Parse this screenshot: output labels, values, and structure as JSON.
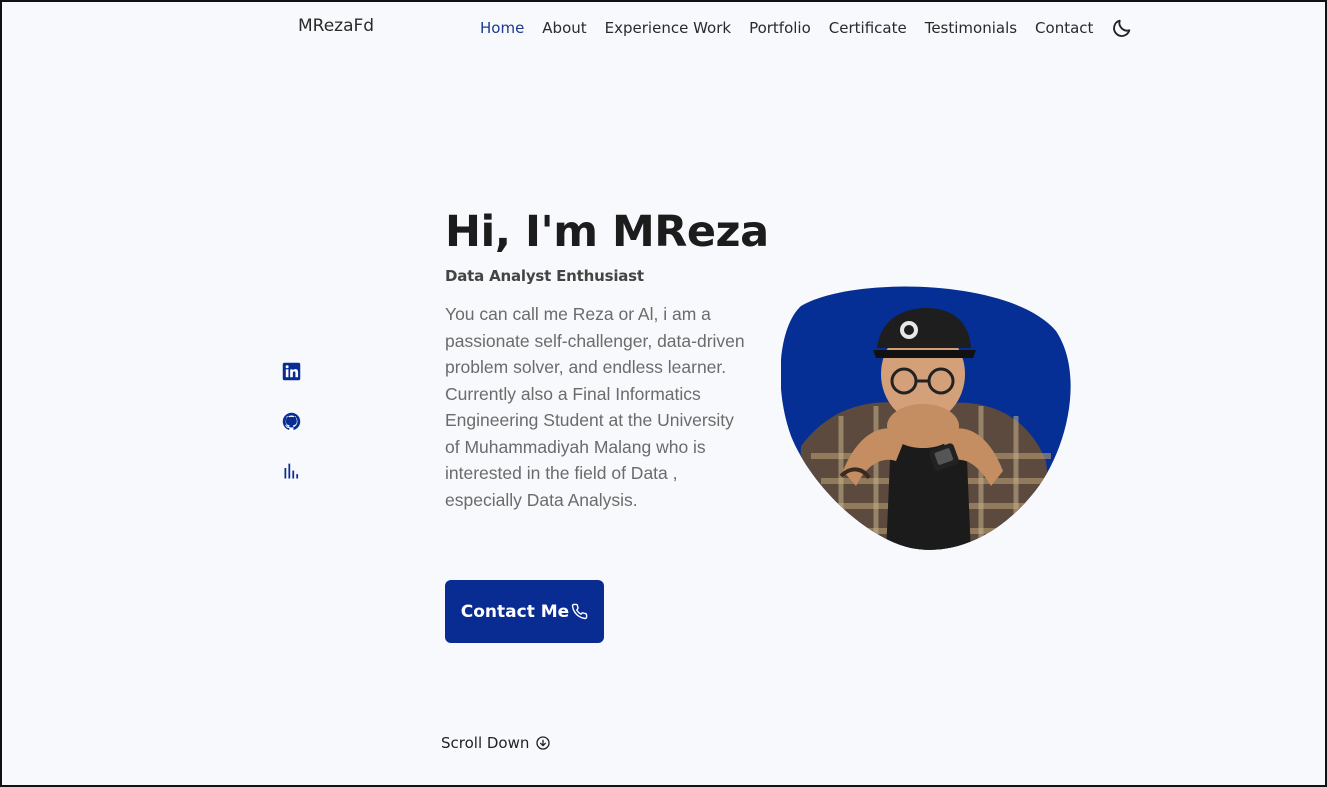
{
  "header": {
    "logo": "MRezaFd",
    "nav": [
      {
        "label": "Home",
        "active": true
      },
      {
        "label": "About"
      },
      {
        "label": "Experience Work"
      },
      {
        "label": "Portfolio"
      },
      {
        "label": "Certificate"
      },
      {
        "label": "Testimonials"
      },
      {
        "label": "Contact"
      }
    ],
    "theme_icon": "moon-icon"
  },
  "socials": [
    {
      "icon": "linkedin-icon"
    },
    {
      "icon": "github-icon"
    },
    {
      "icon": "bar-chart-icon"
    }
  ],
  "hero": {
    "title": "Hi, I'm MReza",
    "subtitle": "Data Analyst Enthusiast",
    "description": "You can call me Reza or Al, i am a passionate self-challenger, data-driven problem solver, and endless learner. Currently also a Final Informatics Engineering Student at the University of Muhammadiyah Malang who is interested in the field of Data , especially Data Analysis.",
    "contact_button": "Contact Me",
    "contact_icon": "phone-icon"
  },
  "scroll": {
    "label": "Scroll Down",
    "icon": "arrow-down-circle-icon"
  },
  "colors": {
    "accent": "#082c91",
    "blob": "#052f94",
    "background": "#f8f9fc"
  }
}
